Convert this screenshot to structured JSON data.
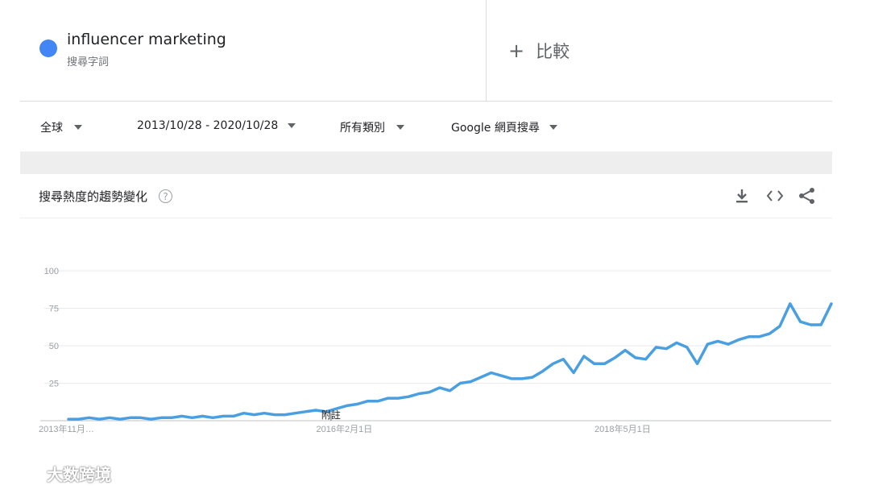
{
  "search_term": {
    "name": "influencer marketing",
    "subtitle": "搜尋字詞",
    "color": "#4285f4"
  },
  "compare": {
    "plus": "+",
    "label": "比較"
  },
  "filters": {
    "region": "全球",
    "date_range": "2013/10/28 - 2020/10/28",
    "category": "所有類別",
    "search_type": "Google 網頁搜尋"
  },
  "section": {
    "title": "搜尋熱度的趨勢變化",
    "help": "?"
  },
  "icons": [
    "download-icon",
    "embed-icon",
    "share-icon"
  ],
  "watermark": {
    "text": "大数跨境"
  },
  "chart_data": {
    "type": "line",
    "title": "",
    "xlabel": "",
    "ylabel": "",
    "ylim": [
      0,
      100
    ],
    "y_ticks": [
      100,
      75,
      50,
      25
    ],
    "x_ticks": [
      "2013年11月…",
      "2016年2月1日",
      "2018年5月1日"
    ],
    "x_tick_index": [
      0,
      27,
      54
    ],
    "annotation": {
      "text": "附註",
      "index": 25
    },
    "grid": true,
    "legend": "none",
    "line_color": "#4a9fe0",
    "series": [
      {
        "values": [
          1,
          1,
          2,
          1,
          2,
          1,
          2,
          2,
          1,
          2,
          2,
          3,
          2,
          3,
          2,
          3,
          3,
          5,
          4,
          5,
          4,
          4,
          5,
          6,
          7,
          6,
          8,
          10,
          11,
          13,
          13,
          15,
          15,
          16,
          18,
          19,
          22,
          20,
          25,
          26,
          29,
          32,
          30,
          28,
          28,
          29,
          33,
          38,
          41,
          32,
          43,
          38,
          38,
          42,
          47,
          42,
          41,
          49,
          48,
          52,
          49,
          38,
          51,
          53,
          51,
          54,
          56,
          56,
          58,
          63,
          78,
          66,
          64,
          64,
          78
        ]
      }
    ]
  }
}
